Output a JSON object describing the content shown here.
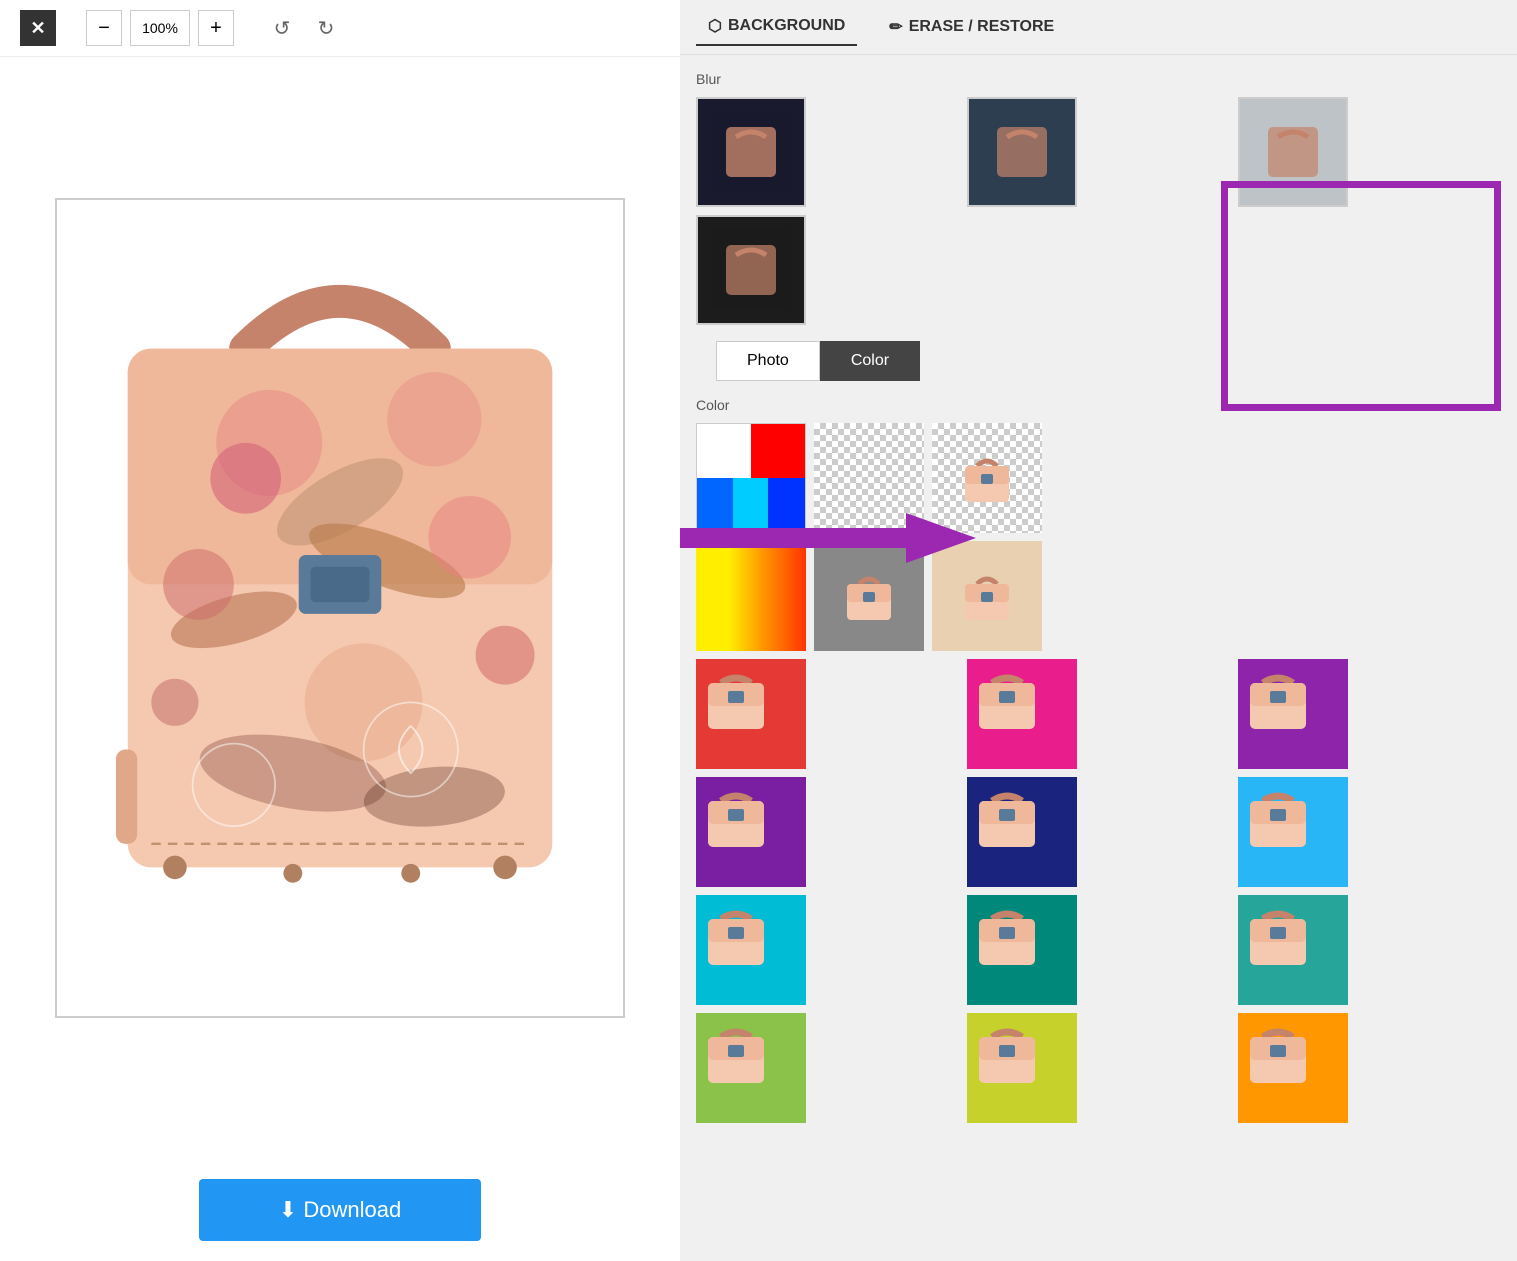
{
  "toolbar": {
    "close_label": "✕",
    "zoom_value": "100%",
    "zoom_in_label": "+",
    "zoom_out_label": "−",
    "undo_label": "↺",
    "redo_label": "↻"
  },
  "download": {
    "label": "⬇ Download"
  },
  "tabs": [
    {
      "id": "background",
      "label": "BACKGROUND",
      "icon": "⬡"
    },
    {
      "id": "erase",
      "label": "ERASE / RESTORE",
      "icon": "✏"
    }
  ],
  "right_panel": {
    "blur_label": "Blur",
    "color_label": "Color",
    "photo_btn": "Photo",
    "color_btn": "Color"
  },
  "blur_thumbnails": [
    {
      "id": "blur-1",
      "style": "dark"
    },
    {
      "id": "blur-2",
      "style": "medium"
    },
    {
      "id": "blur-3",
      "style": "light"
    },
    {
      "id": "blur-4",
      "style": "darker"
    }
  ],
  "color_rows": [
    {
      "id": "row-multicolor",
      "swatches": [
        "#fff",
        "#f00",
        "#00f",
        "#0ff",
        "#ff0",
        "#0f0"
      ]
    },
    {
      "id": "row-warm",
      "swatches": [
        "#ff0",
        "#fa0",
        "#f80",
        "#f60",
        "#f40"
      ]
    }
  ],
  "color_thumbnails": [
    {
      "id": "ct-transparent",
      "bg": "checkerboard",
      "color": "transparent"
    },
    {
      "id": "ct-selected",
      "bg": "#fff",
      "color": "#fff",
      "selected": true
    },
    {
      "id": "ct-none",
      "bg": "#eee",
      "color": "#eee"
    },
    {
      "id": "ct-red",
      "bg": "#e53935",
      "color": "#e53935"
    },
    {
      "id": "ct-hotpink",
      "bg": "#e91e8c",
      "color": "#e91e8c"
    },
    {
      "id": "ct-purple",
      "bg": "#8e24aa",
      "color": "#8e24aa"
    },
    {
      "id": "ct-violet",
      "bg": "#7b1fa2",
      "color": "#7b1fa2"
    },
    {
      "id": "ct-navy",
      "bg": "#1a237e",
      "color": "#1a237e"
    },
    {
      "id": "ct-skyblue",
      "bg": "#29b6f6",
      "color": "#29b6f6"
    },
    {
      "id": "ct-cyan",
      "bg": "#00bcd4",
      "color": "#00bcd4"
    },
    {
      "id": "ct-teal",
      "bg": "#00897b",
      "color": "#00897b"
    },
    {
      "id": "ct-lime",
      "bg": "#7cb342",
      "color": "#7cb342"
    }
  ],
  "accent_color": "#9c27b0"
}
